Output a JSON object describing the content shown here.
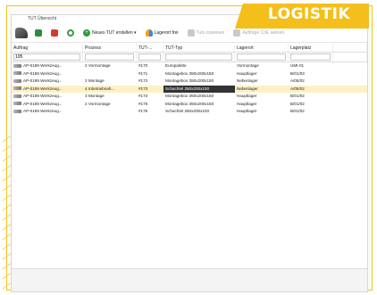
{
  "banner": {
    "label": "LOGISTIK",
    "color": "#f4bf1a"
  },
  "window": {
    "title": "TUT Übersicht"
  },
  "toolbar": {
    "buttons": [
      {
        "icon": "excel-icon",
        "label": ""
      },
      {
        "icon": "pdf-icon",
        "label": ""
      },
      {
        "icon": "refresh-icon",
        "label": ""
      },
      {
        "icon": "add-icon",
        "label": "Neues TUT erstellen ▾"
      },
      {
        "icon": "storage-place-icon",
        "label": "Lagerort frei"
      },
      {
        "icon": "unassign-icon",
        "label": "Tuts zuweisen"
      },
      {
        "icon": "order-edit-icon",
        "label": "Aufträge CoE weisen"
      }
    ]
  },
  "table": {
    "columns": [
      "Auftrag",
      "Prozess",
      "TUT-...",
      "TUT-Typ",
      "Lagerort",
      "Lagerplatz"
    ],
    "filter_value": "105",
    "rows": [
      {
        "auftrag": "AP-0189 Werkzeug...",
        "prozess": "2 Vormontage",
        "tut": "#170",
        "typ": "Europalette",
        "lagerort": "Vormontage",
        "platz": "UMI-01",
        "selected": false
      },
      {
        "auftrag": "AP-0189 Werkzeug...",
        "prozess": "",
        "tut": "#171",
        "typ": "Montagebox 350x200x150",
        "lagerort": "Hauptlager",
        "platz": "B/01/03",
        "selected": false
      },
      {
        "auftrag": "AP-0189 Werkzeug...",
        "prozess": "3 Montage",
        "tut": "#172",
        "typ": "Montagebox 350x200x150",
        "lagerort": "Nebenlager",
        "platz": "A/05/02",
        "selected": false
      },
      {
        "auftrag": "AP-0189 Werkzeug...",
        "prozess": "4 Inbetriebnah...",
        "tut": "#173",
        "typ": "Schachtel 250x200x100",
        "lagerort": "Nebenlager",
        "platz": "A/05/02",
        "selected": true
      },
      {
        "auftrag": "AP-0189 Werkzeug...",
        "prozess": "3 Montage",
        "tut": "#174",
        "typ": "Montagebox 350x200x150",
        "lagerort": "Hauptlager",
        "platz": "B/01/02",
        "selected": false
      },
      {
        "auftrag": "AP-0189 Werkzeug...",
        "prozess": "2 Vormontage",
        "tut": "#175",
        "typ": "Montagebox 350x200x150",
        "lagerort": "Hauptlager",
        "platz": "B/01/02",
        "selected": false
      },
      {
        "auftrag": "AP-0189 Werkzeug...",
        "prozess": "",
        "tut": "#176",
        "typ": "Schachtel 250x200x100",
        "lagerort": "Hauptlager",
        "platz": "B/01/02",
        "selected": false
      }
    ]
  }
}
